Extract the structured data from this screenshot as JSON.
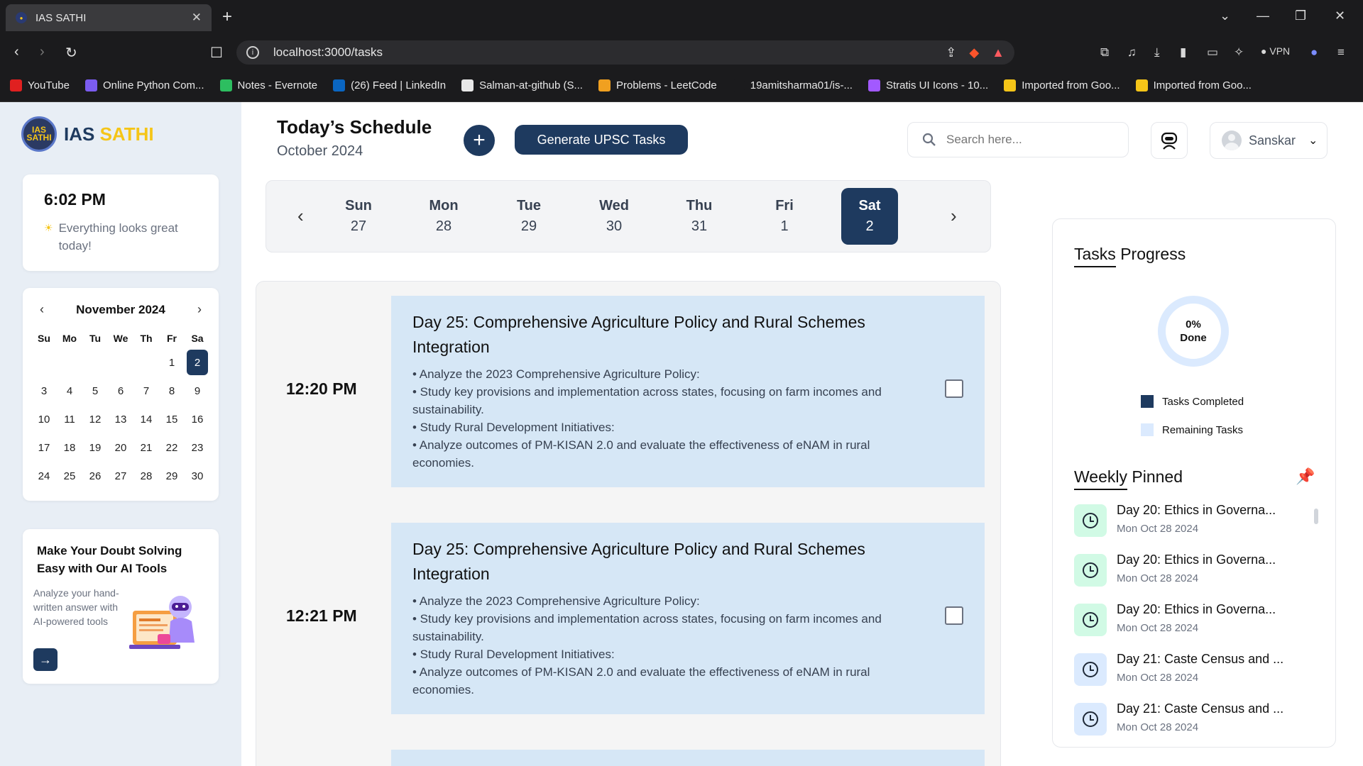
{
  "browser": {
    "tab_title": "IAS SATHI",
    "url": "localhost:3000/tasks",
    "vpn_label": "VPN",
    "bookmarks": [
      {
        "label": "YouTube",
        "color": "#e02020"
      },
      {
        "label": "Online Python Com...",
        "color": "#7b5cf0"
      },
      {
        "label": "Notes - Evernote",
        "color": "#2dbe60"
      },
      {
        "label": "(26) Feed | LinkedIn",
        "color": "#0a66c2"
      },
      {
        "label": "Salman-at-github (S...",
        "color": "#e8e8e8"
      },
      {
        "label": "Problems - LeetCode",
        "color": "#f0a020"
      },
      {
        "label": "19amitsharma01/is-...",
        "color": "#1b1b1d"
      },
      {
        "label": "Stratis UI Icons - 10...",
        "color": "#a259ff"
      },
      {
        "label": "Imported from Goo...",
        "color": "#f5c518"
      },
      {
        "label": "Imported from Goo...",
        "color": "#f5c518"
      }
    ]
  },
  "sidebar": {
    "logo_main": "IAS",
    "logo_accent": "SATHI",
    "logo_badge": "IAS SATHI",
    "time": "6:02 PM",
    "time_message": "Everything looks great today!",
    "calendar": {
      "month": "November 2024",
      "weekdays": [
        "Su",
        "Mo",
        "Tu",
        "We",
        "Th",
        "Fr",
        "Sa"
      ],
      "days": [
        "",
        "",
        "",
        "",
        "",
        "1",
        "2",
        "3",
        "4",
        "5",
        "6",
        "7",
        "8",
        "9",
        "10",
        "11",
        "12",
        "13",
        "14",
        "15",
        "16",
        "17",
        "18",
        "19",
        "20",
        "21",
        "22",
        "23",
        "24",
        "25",
        "26",
        "27",
        "28",
        "29",
        "30"
      ],
      "selected": "2"
    },
    "ai": {
      "title": "Make Your Doubt Solving Easy with Our AI Tools",
      "desc": "Analyze your hand-written answer with AI-powered tools",
      "button": "→"
    }
  },
  "header": {
    "title": "Today’s Schedule",
    "subtitle": "October 2024",
    "add_button": "+",
    "generate_button": "Generate UPSC Tasks",
    "search_placeholder": "Search here...",
    "user_name": "Sanskar"
  },
  "daystrip": {
    "days": [
      {
        "name": "Sun",
        "num": "27"
      },
      {
        "name": "Mon",
        "num": "28"
      },
      {
        "name": "Tue",
        "num": "29"
      },
      {
        "name": "Wed",
        "num": "30"
      },
      {
        "name": "Thu",
        "num": "31"
      },
      {
        "name": "Fri",
        "num": "1"
      },
      {
        "name": "Sat",
        "num": "2"
      }
    ],
    "selected_index": 6
  },
  "tasks": [
    {
      "time": "12:20 PM",
      "title": "Day 25: Comprehensive Agriculture Policy and Rural Schemes Integration",
      "points": [
        "• Analyze the 2023 Comprehensive Agriculture Policy:",
        "• Study key provisions and implementation across states, focusing on farm incomes and sustainability.",
        "• Study Rural Development Initiatives:",
        "• Analyze outcomes of PM-KISAN 2.0 and evaluate the effectiveness of eNAM in rural economies."
      ],
      "done": false
    },
    {
      "time": "12:21 PM",
      "title": "Day 25: Comprehensive Agriculture Policy and Rural Schemes Integration",
      "points": [
        "• Analyze the 2023 Comprehensive Agriculture Policy:",
        "• Study key provisions and implementation across states, focusing on farm incomes and sustainability.",
        "• Study Rural Development Initiatives:",
        "• Analyze outcomes of PM-KISAN 2.0 and evaluate the effectiveness of eNAM in rural economies."
      ],
      "done": false
    }
  ],
  "progress": {
    "title_a": "Tasks",
    "title_b": "Progress",
    "percent_label": "0%",
    "done_label": "Done",
    "percent": 0,
    "legend_completed": "Tasks Completed",
    "legend_remaining": "Remaining Tasks",
    "completed_color": "#1e3a5f",
    "remaining_color": "#dbeafe"
  },
  "pinned": {
    "title_a": "Weekly",
    "title_b": "Pinned",
    "items": [
      {
        "title": "Day 20: Ethics in Governa...",
        "date": "Mon Oct 28 2024",
        "color": "#d1fae5"
      },
      {
        "title": "Day 20: Ethics in Governa...",
        "date": "Mon Oct 28 2024",
        "color": "#d1fae5"
      },
      {
        "title": "Day 20: Ethics in Governa...",
        "date": "Mon Oct 28 2024",
        "color": "#d1fae5"
      },
      {
        "title": "Day 21: Caste Census and ...",
        "date": "Mon Oct 28 2024",
        "color": "#dbeafe"
      },
      {
        "title": "Day 21: Caste Census and ...",
        "date": "Mon Oct 28 2024",
        "color": "#dbeafe"
      }
    ]
  }
}
